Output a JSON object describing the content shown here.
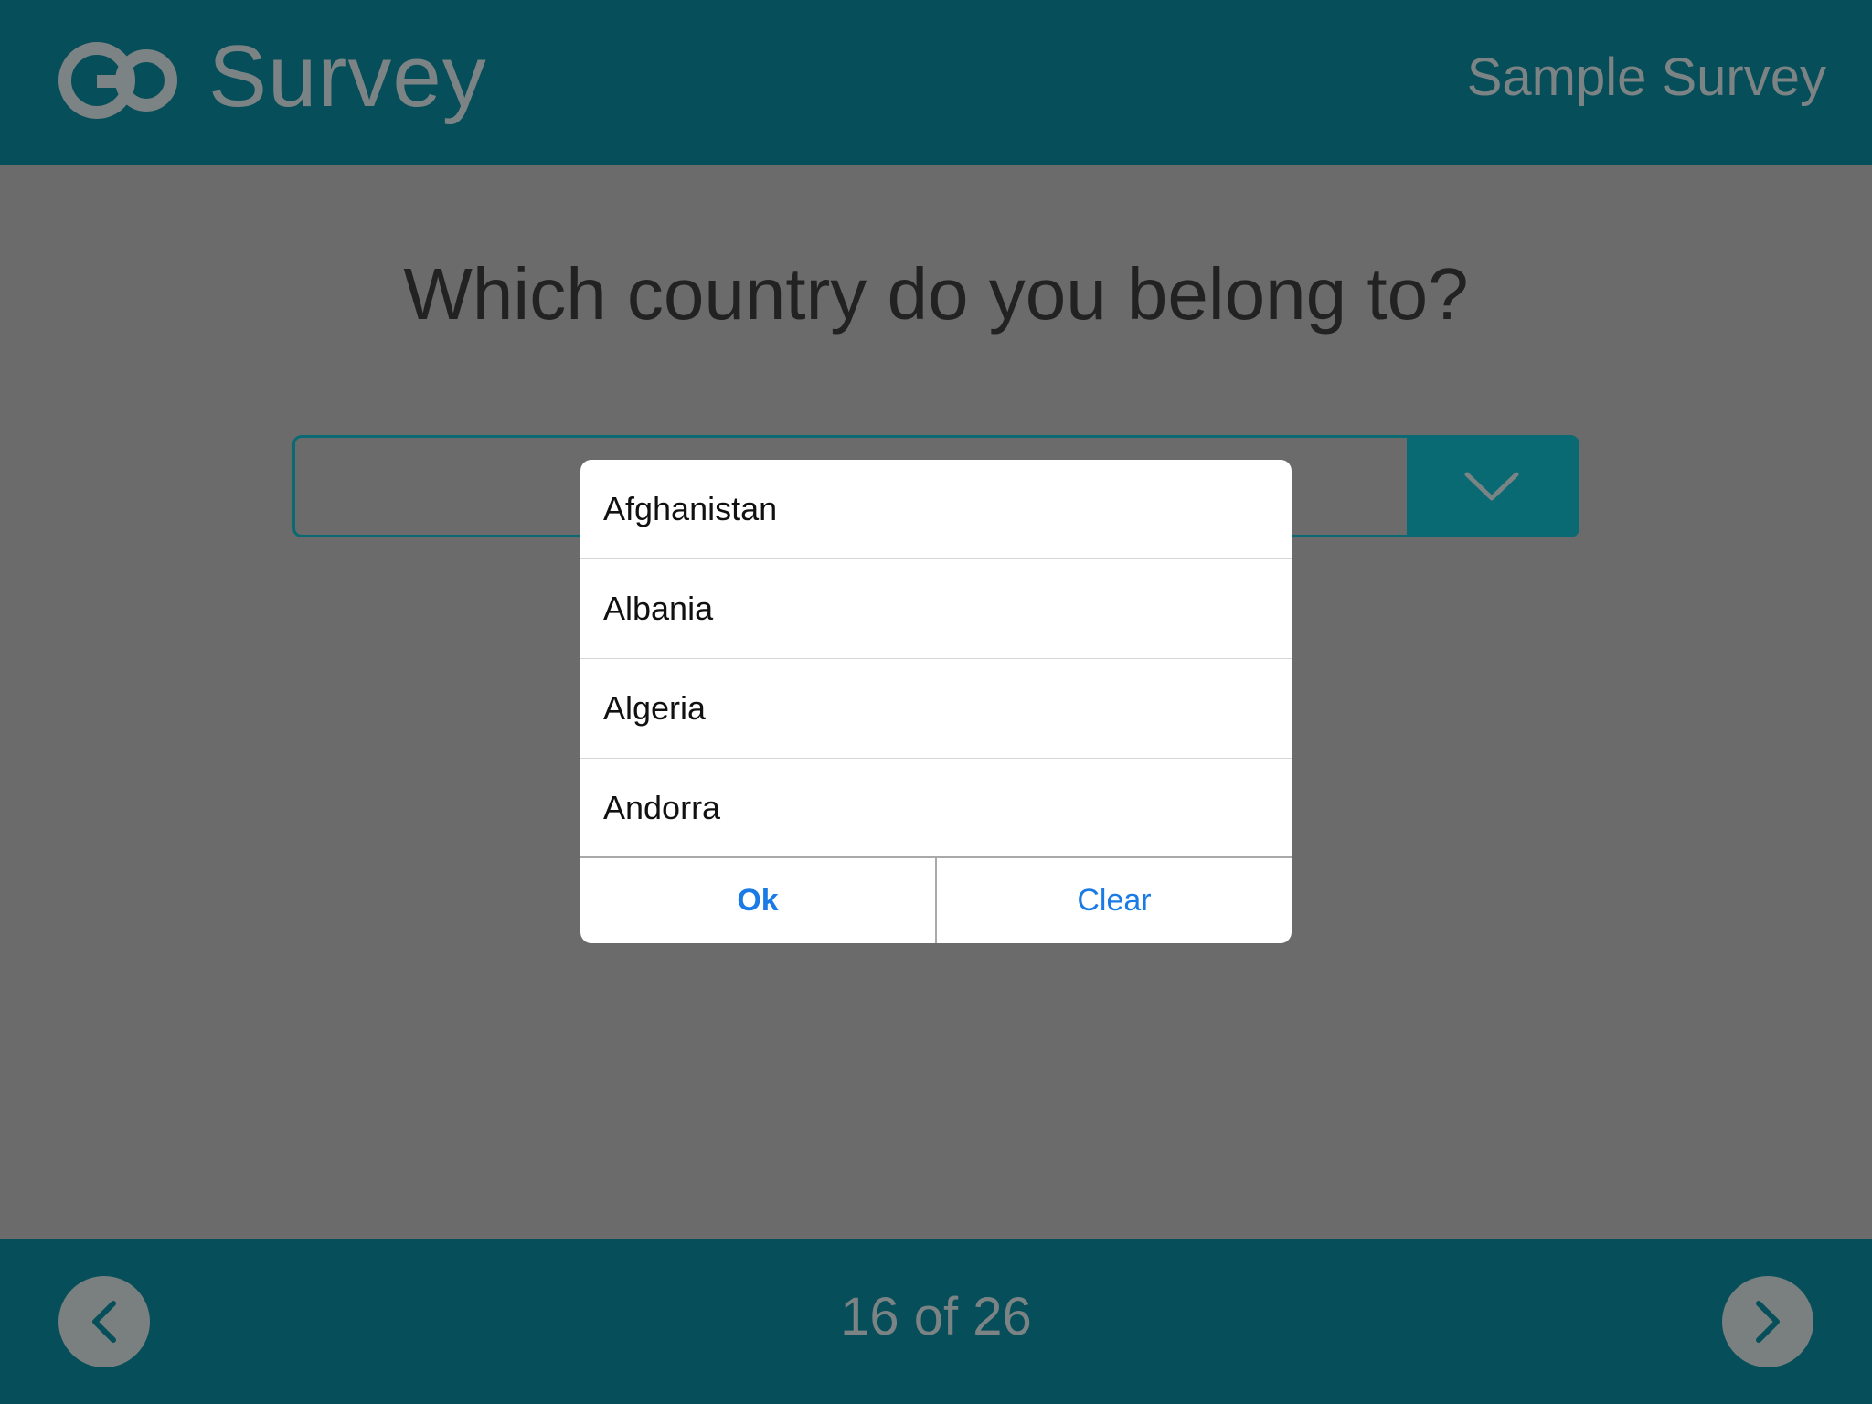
{
  "header": {
    "brand": "Survey",
    "logo_icon": "go-logo-icon",
    "survey_name": "Sample Survey"
  },
  "main": {
    "question": "Which country do you belong to?",
    "dropdown": {
      "value": "",
      "toggle_icon": "chevron-down-icon"
    }
  },
  "picker": {
    "options": [
      "Afghanistan",
      "Albania",
      "Algeria",
      "Andorra"
    ],
    "ok_label": "Ok",
    "clear_label": "Clear"
  },
  "footer": {
    "counter": "16 of 26",
    "prev_icon": "chevron-left-icon",
    "next_icon": "chevron-right-icon"
  },
  "colors": {
    "header_bg": "#064e59",
    "accent": "#0a6a73",
    "overlay_bg": "#6b6b6b",
    "action_blue": "#1a7ae6"
  }
}
